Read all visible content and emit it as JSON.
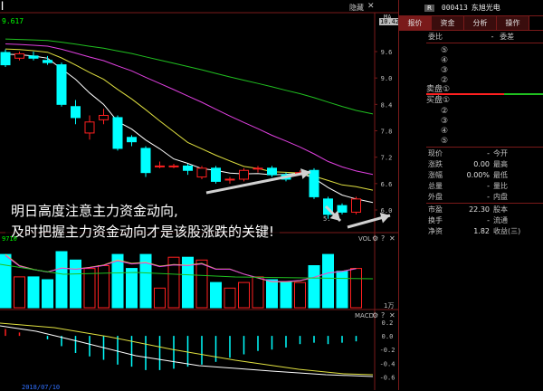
{
  "header": {
    "ma_value": "9.617",
    "hide_label": "隐藏",
    "ma_label": "MA",
    "price_badge": "10.42"
  },
  "price_axis": [
    "9.6",
    "9.0",
    "8.4",
    "7.8",
    "7.2",
    "6.6",
    "6.0"
  ],
  "low_marker": "5.",
  "annotation": {
    "line1": "明日高度注意主力资金动向,",
    "line2": "及时把握主力资金动向才是该股涨跌的关键!"
  },
  "volume_pane": {
    "label": "VOL",
    "unit": "1万",
    "ma_value": "9710"
  },
  "macd_pane": {
    "label": "MACD",
    "axis": [
      "0.2",
      "0.0",
      "-0.2",
      "-0.4",
      "-0.6"
    ],
    "bottom_date": "2018/07/10"
  },
  "candles": [
    {
      "o": 9.58,
      "c": 9.3,
      "h": 9.65,
      "l": 9.25
    },
    {
      "o": 9.45,
      "c": 9.55,
      "h": 9.6,
      "l": 9.4
    },
    {
      "o": 9.5,
      "c": 9.45,
      "h": 9.6,
      "l": 9.4
    },
    {
      "o": 9.4,
      "c": 9.35,
      "h": 9.5,
      "l": 9.3
    },
    {
      "o": 9.3,
      "c": 8.4,
      "h": 9.35,
      "l": 8.35
    },
    {
      "o": 8.35,
      "c": 8.1,
      "h": 8.5,
      "l": 7.95
    },
    {
      "o": 7.75,
      "c": 8.0,
      "h": 8.15,
      "l": 7.6
    },
    {
      "o": 8.05,
      "c": 8.15,
      "h": 8.3,
      "l": 7.95
    },
    {
      "o": 8.1,
      "c": 7.4,
      "h": 8.15,
      "l": 7.35
    },
    {
      "o": 7.65,
      "c": 7.55,
      "h": 7.7,
      "l": 7.45
    },
    {
      "o": 7.4,
      "c": 6.85,
      "h": 7.45,
      "l": 6.75
    },
    {
      "o": 7.0,
      "c": 7.0,
      "h": 7.1,
      "l": 6.95
    },
    {
      "o": 7.0,
      "c": 7.0,
      "h": 7.05,
      "l": 6.95
    },
    {
      "o": 7.0,
      "c": 6.9,
      "h": 7.05,
      "l": 6.8
    },
    {
      "o": 6.75,
      "c": 6.95,
      "h": 7.0,
      "l": 6.7
    },
    {
      "o": 6.95,
      "c": 6.65,
      "h": 7.0,
      "l": 6.6
    },
    {
      "o": 6.7,
      "c": 6.7,
      "h": 6.75,
      "l": 6.6
    },
    {
      "o": 6.7,
      "c": 6.9,
      "h": 6.95,
      "l": 6.65
    },
    {
      "o": 6.95,
      "c": 6.95,
      "h": 7.0,
      "l": 6.85
    },
    {
      "o": 6.95,
      "c": 6.8,
      "h": 7.0,
      "l": 6.75
    },
    {
      "o": 6.8,
      "c": 6.7,
      "h": 6.85,
      "l": 6.65
    },
    {
      "o": 6.85,
      "c": 6.85,
      "h": 6.9,
      "l": 6.8
    },
    {
      "o": 6.9,
      "c": 6.3,
      "h": 6.95,
      "l": 6.25
    },
    {
      "o": 6.25,
      "c": 5.9,
      "h": 6.3,
      "l": 5.8
    },
    {
      "o": 6.1,
      "c": 5.95,
      "h": 6.15,
      "l": 5.9
    },
    {
      "o": 5.95,
      "c": 6.25,
      "h": 6.3,
      "l": 5.9
    }
  ],
  "volumes": [
    0.95,
    0.55,
    0.55,
    0.5,
    1.0,
    0.85,
    0.7,
    0.75,
    0.95,
    0.7,
    0.95,
    0.35,
    0.9,
    0.9,
    0.85,
    0.45,
    0.35,
    0.45,
    0.55,
    0.5,
    0.45,
    0.45,
    0.75,
    0.95,
    0.65,
    0.7
  ],
  "macd_bars": [
    0.1,
    0.05,
    0.0,
    -0.05,
    -0.15,
    -0.25,
    -0.3,
    -0.35,
    -0.42,
    -0.45,
    -0.5,
    -0.5,
    -0.48,
    -0.45,
    -0.42,
    -0.38,
    -0.32,
    -0.27,
    -0.22,
    -0.2,
    -0.17,
    -0.12,
    -0.1,
    -0.12,
    -0.1,
    -0.08
  ],
  "panel": {
    "badge": "R",
    "code": "000413",
    "name": "东旭光电",
    "tabs": [
      "报价",
      "资金",
      "分析",
      "操作"
    ],
    "order_ratio_label": "委比",
    "order_diff_label": "委差",
    "order_diff_value": "-",
    "sell_levels": [
      "⑤",
      "④",
      "③",
      "②"
    ],
    "sell1_label": "卖盘①",
    "buy1_label": "买盘①",
    "buy_levels": [
      "②",
      "③",
      "④",
      "⑤"
    ],
    "quote_rows": [
      {
        "label": "现价",
        "value": "-",
        "label2": "今开"
      },
      {
        "label": "涨跌",
        "value": "0.00",
        "label2": "最高"
      },
      {
        "label": "涨幅",
        "value": "0.00%",
        "label2": "最低"
      },
      {
        "label": "总量",
        "value": "-",
        "label2": "量比"
      },
      {
        "label": "外盘",
        "value": "-",
        "label2": "内盘"
      },
      {
        "label": "市盈",
        "value": "22.30",
        "label2": "股本"
      },
      {
        "label": "换手",
        "value": "-",
        "label2": "流通"
      },
      {
        "label": "净资",
        "value": "1.82",
        "label2": "收益(三)"
      }
    ],
    "colors": {
      "up": "#ff2020",
      "down": "#00ffff",
      "accent": "#7a1a1a"
    }
  }
}
